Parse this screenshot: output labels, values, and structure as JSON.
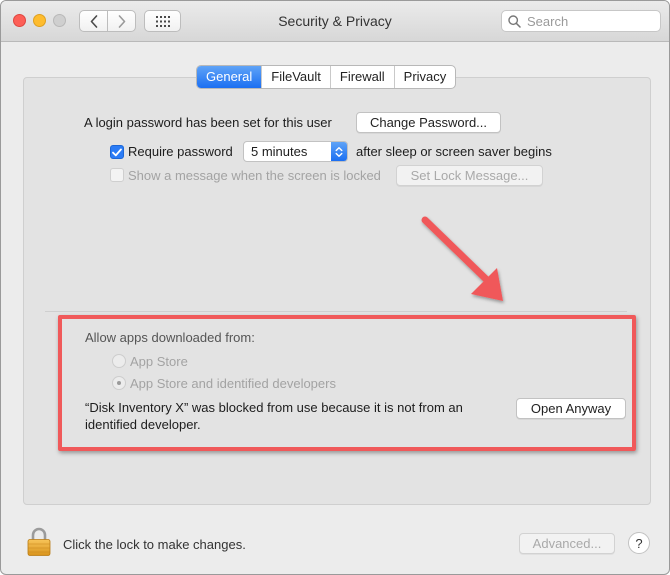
{
  "window": {
    "title": "Security & Privacy"
  },
  "toolbar": {
    "search_placeholder": "Search"
  },
  "tabs": [
    {
      "label": "General",
      "active": true
    },
    {
      "label": "FileVault",
      "active": false
    },
    {
      "label": "Firewall",
      "active": false
    },
    {
      "label": "Privacy",
      "active": false
    }
  ],
  "general": {
    "login_password_text": "A login password has been set for this user",
    "change_password_label": "Change Password...",
    "require_password_label": "Require password",
    "require_password_checked": true,
    "require_password_delay": "5 minutes",
    "after_sleep_text": "after sleep or screen saver begins",
    "show_message_label": "Show a message when the screen is locked",
    "show_message_checked": false,
    "set_lock_message_label": "Set Lock Message..."
  },
  "gatekeeper": {
    "heading": "Allow apps downloaded from:",
    "options": [
      {
        "label": "App Store",
        "selected": false
      },
      {
        "label": "App Store and identified developers",
        "selected": true
      }
    ],
    "blocked_message": "“Disk Inventory X” was blocked from use because it is not from an identified developer.",
    "open_anyway_label": "Open Anyway"
  },
  "footer": {
    "lock_text": "Click the lock to make changes.",
    "advanced_label": "Advanced...",
    "help_label": "?"
  },
  "colors": {
    "accent": "#1b6ff2",
    "annotation": "#f0595a"
  },
  "icons": {
    "back": "chevron-left-icon",
    "forward": "chevron-right-icon",
    "grid": "grid-icon",
    "search": "search-icon",
    "lock": "lock-icon",
    "annotation_arrow": "arrow-icon"
  }
}
